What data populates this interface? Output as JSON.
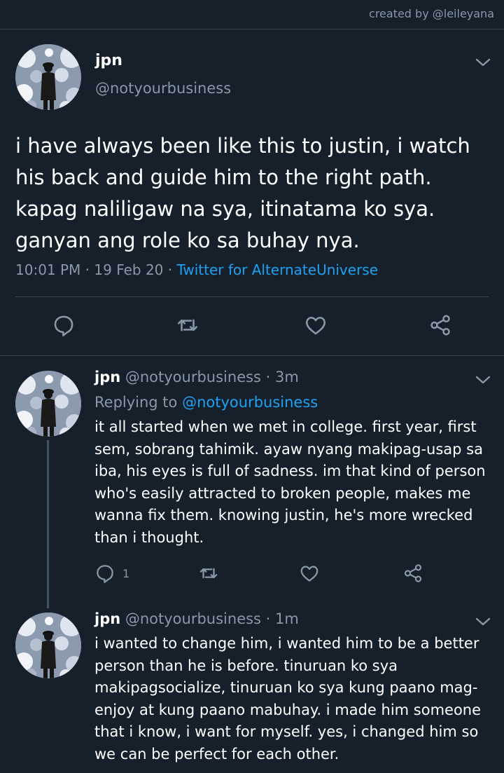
{
  "credit": "created by @leileyana",
  "main_tweet": {
    "name": "jpn",
    "handle": "@notyourbusiness",
    "text": "i have always been like this to justin, i watch his back and guide him to the right path. kapag naliligaw na sya, itinatama ko sya. ganyan ang role ko sa buhay nya.",
    "timestamp": "10:01 PM · 19 Feb 20 · ",
    "source": "Twitter for AlternateUniverse",
    "actions": [
      "reply-icon",
      "retweet-icon",
      "like-icon",
      "share-icon"
    ]
  },
  "replies": [
    {
      "name": "jpn",
      "handle_time": " @notyourbusiness · 3m",
      "replying_label": "Replying to ",
      "replying_handle": "@notyourbusiness",
      "text": "it all started when we met in college. first year, first sem, sobrang tahimik. ayaw nyang makipag-usap sa iba, his eyes is full of sadness. im that kind of person who's easily attracted to broken people, makes me wanna fix them. knowing justin, he's more wrecked than i thought.",
      "reply_count": "1"
    },
    {
      "name": "jpn",
      "handle_time": " @notyourbusiness · 1m",
      "text": "i wanted to change him, i wanted him to be a better person than he is before. tinuruan ko sya makipagsocialize, tinuruan ko sya kung paano mag-enjoy at kung paano mabuhay. i made him someone that i know, i want for myself. yes, i changed him so we can be perfect for each other."
    }
  ],
  "colors": {
    "background": "#15202b",
    "secondary_text": "#8899a6",
    "link": "#1da1f2",
    "divider": "#38444d"
  }
}
